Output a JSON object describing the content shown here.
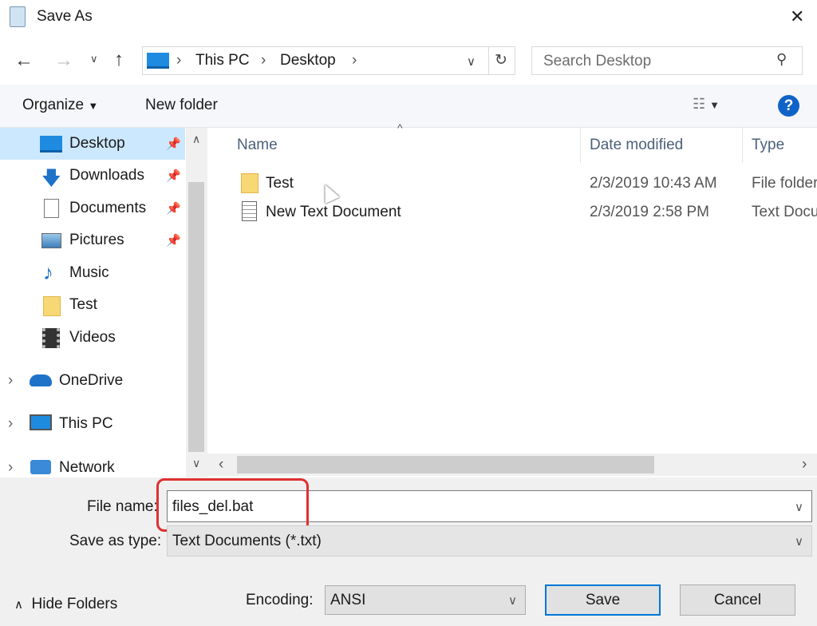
{
  "window": {
    "title": "Save As",
    "close": "✕"
  },
  "address": {
    "crumbs": [
      "This PC",
      "Desktop"
    ],
    "search_placeholder": "Search Desktop"
  },
  "toolbar": {
    "organize": "Organize",
    "new_folder": "New folder",
    "help": "?"
  },
  "nav": {
    "quick": [
      {
        "label": "Desktop",
        "icon": "desktop-icon",
        "pinned": true,
        "selected": true
      },
      {
        "label": "Downloads",
        "icon": "download-icon",
        "pinned": true
      },
      {
        "label": "Documents",
        "icon": "documents-icon",
        "pinned": true
      },
      {
        "label": "Pictures",
        "icon": "pictures-icon",
        "pinned": true
      },
      {
        "label": "Music",
        "icon": "music-icon"
      },
      {
        "label": "Test",
        "icon": "folder-icon"
      },
      {
        "label": "Videos",
        "icon": "videos-icon"
      }
    ],
    "top": [
      {
        "label": "OneDrive",
        "icon": "cloud-icon"
      },
      {
        "label": "This PC",
        "icon": "computer-icon"
      },
      {
        "label": "Network",
        "icon": "network-icon"
      }
    ]
  },
  "columns": {
    "name": "Name",
    "date": "Date modified",
    "type": "Type"
  },
  "files": [
    {
      "name": "Test",
      "date": "2/3/2019 10:43 AM",
      "type": "File folder",
      "icon": "folder-icon"
    },
    {
      "name": "New Text Document",
      "date": "2/3/2019 2:58 PM",
      "type": "Text Document",
      "icon": "text-file-icon"
    }
  ],
  "form": {
    "file_name_label": "File name:",
    "file_name": "files_del.bat",
    "type_label": "Save as type:",
    "type_value": "Text Documents (*.txt)",
    "encoding_label": "Encoding:",
    "encoding_value": "ANSI"
  },
  "buttons": {
    "hide_folders": "Hide Folders",
    "save": "Save",
    "cancel": "Cancel"
  },
  "colors": {
    "selection": "#cce8ff",
    "accent": "#0078d7",
    "highlight": "#e03030"
  }
}
